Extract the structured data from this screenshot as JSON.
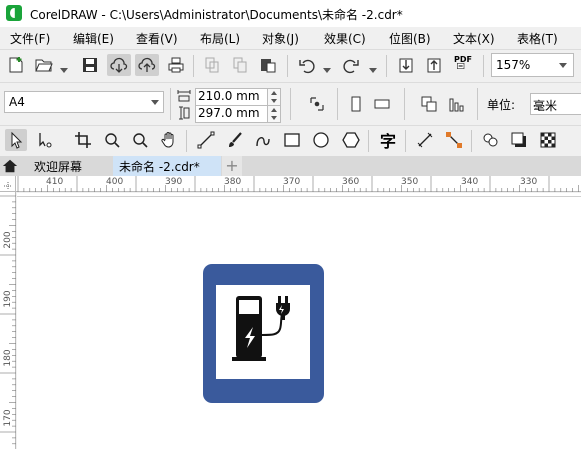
{
  "window": {
    "title": "CorelDRAW - C:\\Users\\Administrator\\Documents\\未命名 -2.cdr*"
  },
  "menu": {
    "items": [
      {
        "label": "文件(F)"
      },
      {
        "label": "编辑(E)"
      },
      {
        "label": "查看(V)"
      },
      {
        "label": "布局(L)"
      },
      {
        "label": "对象(J)"
      },
      {
        "label": "效果(C)"
      },
      {
        "label": "位图(B)"
      },
      {
        "label": "文本(X)"
      },
      {
        "label": "表格(T)"
      }
    ]
  },
  "toolbar": {
    "zoom_value": "157%",
    "pdf_label": "PDF"
  },
  "property_bar": {
    "page_size": "A4",
    "width": "210.0 mm",
    "height": "297.0 mm",
    "unit_label": "单位:",
    "unit_value": "毫米"
  },
  "toolbox": {
    "text_tool_glyph": "字"
  },
  "tabs": {
    "welcome": "欢迎屏幕",
    "document": "未命名 -2.cdr*",
    "add": "+"
  },
  "rulers": {
    "horizontal": [
      "410",
      "400",
      "390",
      "380",
      "370",
      "360",
      "350",
      "340",
      "330"
    ],
    "vertical": [
      "200",
      "190",
      "180",
      "170"
    ]
  },
  "colors": {
    "sign_blue": "#3a5a9c",
    "logo_green": "#1aa43a",
    "active_tab": "#cfe3f7"
  },
  "icons": [
    "home-icon",
    "charging-station-icon",
    "plug-icon",
    "lightning-icon"
  ]
}
